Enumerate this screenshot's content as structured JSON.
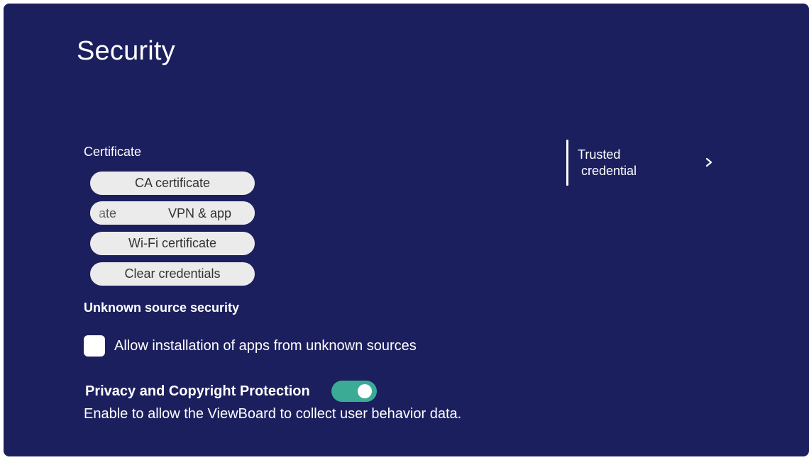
{
  "page": {
    "title": "Security"
  },
  "certificate": {
    "label": "Certificate",
    "buttons": {
      "ca": "CA certificate",
      "vpn_fragment_left": "ate",
      "vpn_fragment_right": "VPN & app",
      "wifi": "Wi-Fi certificate",
      "clear": "Clear credentials"
    }
  },
  "unknown_source": {
    "heading": "Unknown source security",
    "checkbox_label": "Allow installation of apps from unknown sources",
    "checked": false
  },
  "privacy": {
    "title": "Privacy and Copyright Protection",
    "enabled": true,
    "description": "Enable to allow the ViewBoard to collect user behavior data."
  },
  "sidebar": {
    "trusted_label": "Trusted\n credential"
  },
  "colors": {
    "background": "#1c1f5e",
    "pill": "#ebebeb",
    "toggle_on": "#3bab96",
    "text": "#ffffff"
  },
  "icons": {
    "trusted_chevron": "chevron-right-icon"
  }
}
